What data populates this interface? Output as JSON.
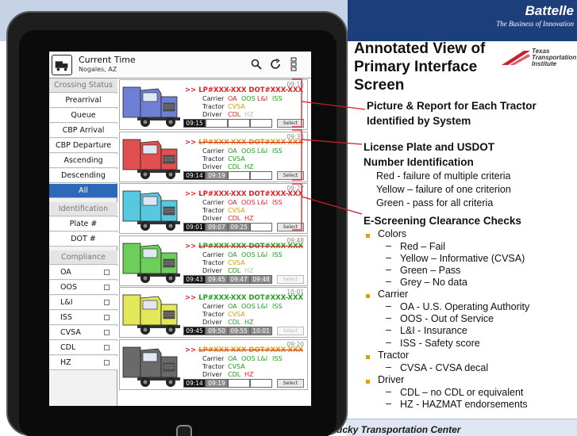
{
  "slide": {
    "brand": {
      "name": "Battelle",
      "tagline": "The Business of Innovation"
    },
    "tti": {
      "line1": "Texas",
      "line2": "Transportation",
      "line3": "Institute"
    },
    "footer": "tucky Transportation Center",
    "title_lines": [
      "Annotated View of",
      "Primary Interface",
      "Screen"
    ],
    "annotations": {
      "a1": {
        "line1": "Picture & Report for Each Tractor",
        "line2": "Identified by System"
      },
      "a2": {
        "line1": "License Plate and USDOT",
        "line2": "Number Identification",
        "items": [
          "Red - failure of multiple criteria",
          "Yellow – failure of one criterion",
          "Green - pass for all criteria"
        ]
      },
      "a3": {
        "head": "E-Screening Clearance Checks",
        "colors": {
          "label": "Colors",
          "items": [
            "Red – Fail",
            "Yellow – Informative (CVSA)",
            "Green – Pass",
            "Grey – No data"
          ]
        },
        "carrier": {
          "label": "Carrier",
          "items": [
            "OA - U.S. Operating Authority",
            "OOS - Out of Service",
            "L&I - Insurance",
            "ISS - Safety score"
          ]
        },
        "tractor": {
          "label": "Tractor",
          "items": [
            "CVSA - CVSA decal"
          ]
        },
        "driver": {
          "label": "Driver",
          "items": [
            "CDL – no CDL or equivalent",
            "HZ - HAZMAT endorsements"
          ]
        }
      }
    }
  },
  "app": {
    "title": "Current Time",
    "location": "Nogales, AZ",
    "sidebar": {
      "crossing_status": "Crossing Status",
      "prearrival": "Prearrival",
      "queue": "Queue",
      "cbp_arrival": "CBP Arrival",
      "cbp_departure": "CBP Departure",
      "ascending": "Ascending",
      "descending": "Descending",
      "all": "All",
      "identification": "Identification",
      "plate": "Plate #",
      "dot": "DOT #",
      "compliance": "Compliance",
      "checks": [
        "OA",
        "OOS",
        "L&I",
        "ISS",
        "CVSA",
        "CDL",
        "HZ"
      ]
    },
    "card_labels": {
      "carrier": "Carrier",
      "tractor": "Tractor",
      "driver": "Driver",
      "select": "Select",
      "arrow": ">>"
    },
    "cards": [
      {
        "time": "09:15",
        "truck_color": "#6f7fd6",
        "lp_text": "LP#XXX-XXX DOT#XXX-XXX",
        "lp_class": "red",
        "strike": false,
        "checks": {
          "oa": [
            "OA",
            "red"
          ],
          "oos": [
            "OOS",
            "grn"
          ],
          "li": [
            "L&I",
            "red"
          ],
          "iss": [
            "ISS",
            "grn"
          ],
          "cvsa": [
            "CVSA",
            "yel"
          ],
          "cdl": [
            "CDL",
            "red"
          ],
          "hz": [
            "HZ",
            "gry"
          ]
        },
        "times": [
          [
            "09:15",
            "black"
          ],
          [
            "",
            "empty"
          ],
          [
            "",
            "empty"
          ],
          [
            "",
            "empty"
          ]
        ],
        "select_faded": false
      },
      {
        "time": "09:33",
        "truck_color": "#e05050",
        "lp_text": "LP#XXX-XXX DOT#XXX-XXX",
        "lp_class": "yel",
        "strike": true,
        "checks": {
          "oa": [
            "OA",
            "grn"
          ],
          "oos": [
            "OOS",
            "grn"
          ],
          "li": [
            "L&I",
            "grn"
          ],
          "iss": [
            "ISS",
            "grn"
          ],
          "cvsa": [
            "CVSA",
            "grn"
          ],
          "cdl": [
            "CDL",
            "grn"
          ],
          "hz": [
            "HZ",
            "grn"
          ]
        },
        "times": [
          [
            "09:14",
            "black"
          ],
          [
            "09:19",
            "grey"
          ],
          [
            "",
            "empty"
          ],
          [
            "",
            "empty"
          ]
        ],
        "select_faded": false
      },
      {
        "time": "09:27",
        "truck_color": "#58c8e0",
        "lp_text": "LP#XXX-XXX DOT#XXX-XXX",
        "lp_class": "red",
        "strike": false,
        "checks": {
          "oa": [
            "OA",
            "red"
          ],
          "oos": [
            "OOS",
            "red"
          ],
          "li": [
            "L&I",
            "red"
          ],
          "iss": [
            "ISS",
            "red"
          ],
          "cvsa": [
            "CVSA",
            "yel"
          ],
          "cdl": [
            "CDL",
            "red"
          ],
          "hz": [
            "HZ",
            "red"
          ]
        },
        "times": [
          [
            "09:01",
            "black"
          ],
          [
            "09:07",
            "grey"
          ],
          [
            "09:25",
            "grey"
          ],
          [
            "",
            "empty"
          ]
        ],
        "select_faded": false
      },
      {
        "time": "09:48",
        "truck_color": "#6ccf5a",
        "lp_text": "LP#XXX-XXX DOT#XXX-XXX",
        "lp_class": "grn",
        "strike": true,
        "checks": {
          "oa": [
            "OA",
            "grn"
          ],
          "oos": [
            "OOS",
            "grn"
          ],
          "li": [
            "L&I",
            "grn"
          ],
          "iss": [
            "ISS",
            "grn"
          ],
          "cvsa": [
            "CVSA",
            "yel"
          ],
          "cdl": [
            "CDL",
            "grn"
          ],
          "hz": [
            "HZ",
            "gry"
          ]
        },
        "times": [
          [
            "09:43",
            "black"
          ],
          [
            "09:45",
            "grey"
          ],
          [
            "09:47",
            "grey"
          ],
          [
            "09:48",
            "grey"
          ]
        ],
        "select_faded": true
      },
      {
        "time": "10:01",
        "truck_color": "#e3e85a",
        "lp_text": "LP#XXX-XXX DOT#XXX-XXX",
        "lp_class": "grn",
        "strike": false,
        "checks": {
          "oa": [
            "OA",
            "grn"
          ],
          "oos": [
            "OOS",
            "grn"
          ],
          "li": [
            "L&I",
            "grn"
          ],
          "iss": [
            "ISS",
            "grn"
          ],
          "cvsa": [
            "CVSA",
            "yel"
          ],
          "cdl": [
            "CDL",
            "grn"
          ],
          "hz": [
            "HZ",
            "grn"
          ]
        },
        "times": [
          [
            "09:45",
            "black"
          ],
          [
            "09:50",
            "grey"
          ],
          [
            "09:55",
            "grey"
          ],
          [
            "10:01",
            "grey"
          ]
        ],
        "select_faded": true
      },
      {
        "time": "09:20",
        "truck_color": "#6a6a6a",
        "lp_text": "LP#XXX-XXX DOT#XXX-XXX",
        "lp_class": "yel",
        "strike": true,
        "checks": {
          "oa": [
            "OA",
            "grn"
          ],
          "oos": [
            "OOS",
            "grn"
          ],
          "li": [
            "L&I",
            "grn"
          ],
          "iss": [
            "ISS",
            "grn"
          ],
          "cvsa": [
            "CVSA",
            "grn"
          ],
          "cdl": [
            "CDL",
            "grn"
          ],
          "hz": [
            "HZ",
            "red"
          ]
        },
        "times": [
          [
            "09:14",
            "black"
          ],
          [
            "09:19",
            "grey"
          ],
          [
            "",
            "empty"
          ],
          [
            "",
            "empty"
          ]
        ],
        "select_faded": false
      }
    ]
  }
}
